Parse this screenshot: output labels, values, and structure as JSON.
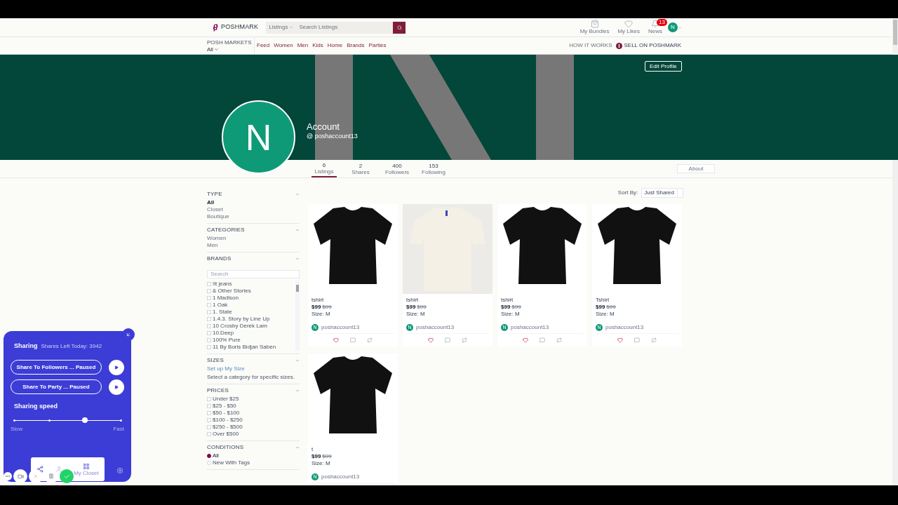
{
  "header": {
    "logo": "POSHMARK",
    "search_scope": "Listings",
    "search_placeholder": "Search Listings",
    "icons": [
      {
        "kind": "bag",
        "label": "My Bundles"
      },
      {
        "kind": "heart",
        "label": "My Likes"
      },
      {
        "kind": "bell",
        "label": "News",
        "badge": "13"
      }
    ],
    "avatar": "N"
  },
  "nav": {
    "markets_label": "POSH MARKETS",
    "market": "All",
    "links": [
      "Feed",
      "Women",
      "Men",
      "Kids",
      "Home",
      "Brands",
      "Parties"
    ],
    "how_it_works": "HOW IT WORKS",
    "sell": "SELL ON POSHMARK"
  },
  "profile": {
    "edit_button": "Edit Profile",
    "avatar": "N",
    "name": "Account",
    "handle": "@ poshaccount13",
    "about": "About",
    "stats": [
      {
        "value": "6",
        "label": "Listings",
        "selected": true
      },
      {
        "value": "2",
        "label": "Shares",
        "selected": false
      },
      {
        "value": "400",
        "label": "Followers",
        "selected": false
      },
      {
        "value": "153",
        "label": "Following",
        "selected": false
      }
    ]
  },
  "filters": [
    {
      "kind": "list",
      "title": "TYPE",
      "items": [
        {
          "label": "All",
          "selected": true
        },
        {
          "label": "Closet",
          "selected": false
        },
        {
          "label": "Boutique",
          "selected": false
        }
      ]
    },
    {
      "kind": "list",
      "title": "CATEGORIES",
      "items": [
        {
          "label": "Women",
          "selected": false
        },
        {
          "label": "Men",
          "selected": false
        }
      ]
    },
    {
      "kind": "brands",
      "title": "BRANDS",
      "placeholder": "Search",
      "items": [
        {
          "label": "!it jeans",
          "checked": false
        },
        {
          "label": "& Other Stories",
          "checked": false
        },
        {
          "label": "1 Madison",
          "checked": false
        },
        {
          "label": "1 Oak",
          "checked": false
        },
        {
          "label": "1. State",
          "checked": false
        },
        {
          "label": "1.4.3. Story by Line Up",
          "checked": false
        },
        {
          "label": "10 Crosby Derek Lam",
          "checked": false
        },
        {
          "label": "10.Deep",
          "checked": false
        },
        {
          "label": "100% Pure",
          "checked": false
        },
        {
          "label": "11 By Boris Bidjan Saben",
          "checked": false
        }
      ]
    },
    {
      "kind": "sizes",
      "title": "SIZES",
      "link": "Set up My Size",
      "note": "Select a category for specific sizes."
    },
    {
      "kind": "checks",
      "title": "PRICES",
      "items": [
        {
          "label": "Under $25",
          "checked": false
        },
        {
          "label": "$25 - $50",
          "checked": false
        },
        {
          "label": "$50 - $100",
          "checked": false
        },
        {
          "label": "$100 - $250",
          "checked": false
        },
        {
          "label": "$250 - $500",
          "checked": false
        },
        {
          "label": "Over $500",
          "checked": false
        }
      ]
    },
    {
      "kind": "radios",
      "title": "CONDITIONS",
      "items": [
        {
          "label": "All",
          "selected": true
        },
        {
          "label": "New With Tags",
          "selected": false
        }
      ]
    }
  ],
  "sort": {
    "label": "Sort By:",
    "value": "Just Shared"
  },
  "listings": [
    {
      "title": "tshirt",
      "price": "$99",
      "original_price": "$99",
      "size": "Size: M",
      "seller": "poshaccount13",
      "seller_initial": "N"
    },
    {
      "title": "tshirt",
      "price": "$99",
      "original_price": "$99",
      "size": "Size: M",
      "seller": "poshaccount13",
      "seller_initial": "N"
    },
    {
      "title": "tshirt",
      "price": "$99",
      "original_price": "$99",
      "size": "Size: M",
      "seller": "poshaccount13",
      "seller_initial": "N"
    },
    {
      "title": "Tshirt",
      "price": "$99",
      "original_price": "$99",
      "size": "Size: M",
      "seller": "poshaccount13",
      "seller_initial": "N"
    },
    {
      "title": "t",
      "price": "$99",
      "original_price": "$99",
      "size": "Size: M",
      "seller": "poshaccount13",
      "seller_initial": "N"
    }
  ],
  "sharing_widget": {
    "title": "Sharing",
    "shares_left": "Shares Left Today: 3942",
    "actions": [
      {
        "label": "Share To Followers ... Paused"
      },
      {
        "label": "Share To Party ... Paused"
      }
    ],
    "speed_title": "Sharing speed",
    "level": 0.667,
    "slow": "Slow",
    "fast": "Fast",
    "closet_label": "My Closet"
  }
}
